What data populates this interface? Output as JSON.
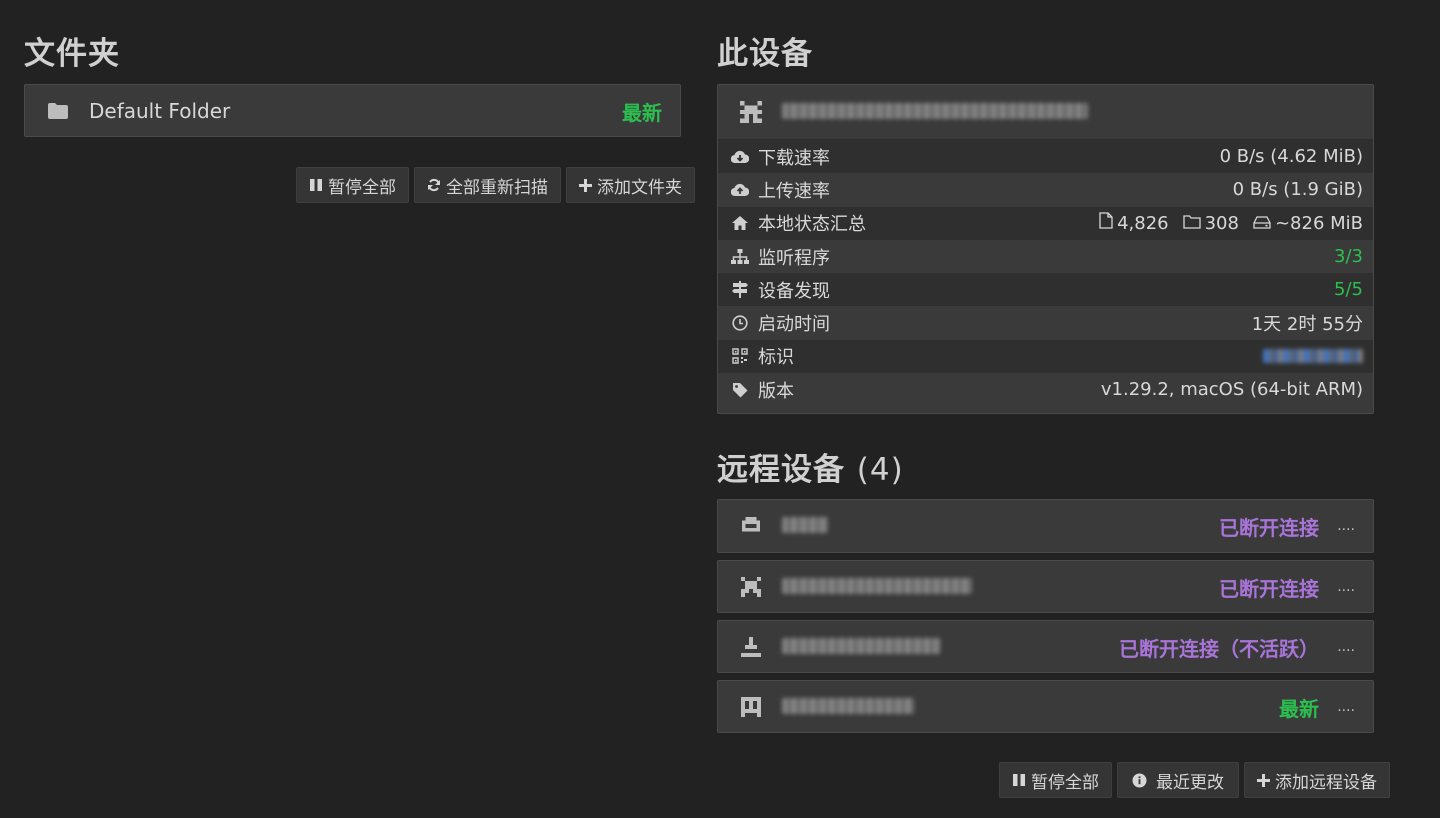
{
  "folders": {
    "title": "文件夹",
    "items": [
      {
        "name": "Default Folder",
        "status": "最新",
        "icon": "folder-icon"
      }
    ],
    "buttons": {
      "pause_all": "暂停全部",
      "rescan_all": "全部重新扫描",
      "add_folder": "添加文件夹"
    }
  },
  "this_device": {
    "title": "此设备",
    "icon": "identicon",
    "stats": [
      {
        "icon": "cloud-download-icon",
        "label": "下载速率",
        "value": "0 B/s (4.62 MiB)"
      },
      {
        "icon": "cloud-upload-icon",
        "label": "上传速率",
        "value": "0 B/s (1.9 GiB)"
      },
      {
        "icon": "home-icon",
        "label": "本地状态汇总",
        "files": "4,826",
        "dirs": "308",
        "size": "~826 MiB"
      },
      {
        "icon": "sitemap-icon",
        "label": "监听程序",
        "value": "3/3"
      },
      {
        "icon": "signpost-icon",
        "label": "设备发现",
        "value": "5/5"
      },
      {
        "icon": "clock-icon",
        "label": "启动时间",
        "value": "1天 2时 55分"
      },
      {
        "icon": "qrcode-icon",
        "label": "标识",
        "value": ""
      },
      {
        "icon": "tag-icon",
        "label": "版本",
        "value": "v1.29.2, macOS (64-bit ARM)"
      }
    ]
  },
  "remote_devices": {
    "title": "远程设备",
    "count": "(4)",
    "items": [
      {
        "status": "已断开连接",
        "dots": "....",
        "status_type": "off"
      },
      {
        "status": "已断开连接",
        "dots": "....",
        "status_type": "off"
      },
      {
        "status": "已断开连接（不活跃）",
        "dots": "....",
        "status_type": "off"
      },
      {
        "status": "最新",
        "dots": "....",
        "status_type": "ok"
      }
    ],
    "buttons": {
      "pause_all": "暂停全部",
      "recent_changes": "最近更改",
      "add_remote": "添加远程设备"
    }
  },
  "colors": {
    "background": "#222222",
    "panel": "#3a3a3a",
    "ok_green": "#2cbf4f",
    "disconnected_purple": "#a974d8"
  }
}
